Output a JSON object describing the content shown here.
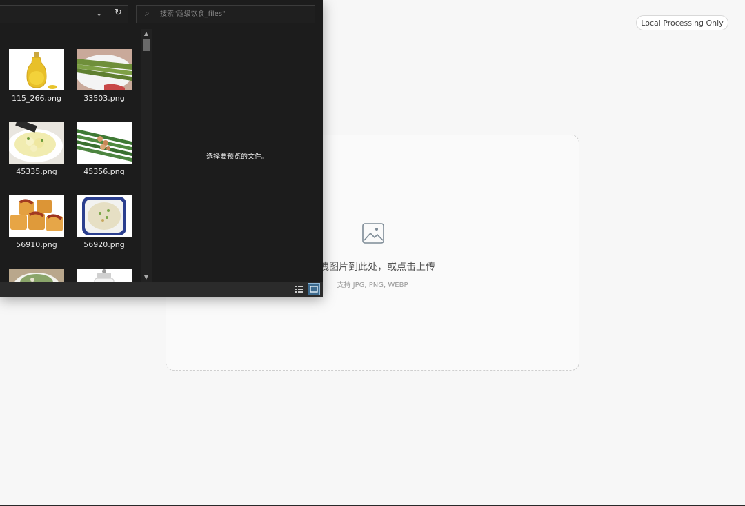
{
  "app": {
    "badge": "Local Processing Only",
    "dropzone": {
      "title": "拖拽图片到此处，或点击上传",
      "subtitle": "支持 JPG, PNG, WEBP",
      "icon": "image-icon"
    }
  },
  "dialog": {
    "search_placeholder": "搜索\"超级饮食_files\"",
    "preview_message": "选择要预览的文件。",
    "files": [
      {
        "name": "115_266.png",
        "icon": "oil-bottle-thumb"
      },
      {
        "name": "33503.png",
        "icon": "asparagus-plate-thumb"
      },
      {
        "name": "45335.png",
        "icon": "potato-salad-thumb"
      },
      {
        "name": "45356.png",
        "icon": "asparagus-nuts-thumb"
      },
      {
        "name": "56910.png",
        "icon": "glazed-tofu-thumb"
      },
      {
        "name": "56920.png",
        "icon": "rice-dish-thumb"
      },
      {
        "name": "",
        "icon": "salad-bowl-thumb"
      },
      {
        "name": "",
        "icon": "glass-jar-thumb"
      }
    ]
  },
  "colors": {
    "dialog_bg": "#1c1c1c",
    "page_bg": "#f7f7f7",
    "accent": "#3d6b8f"
  }
}
